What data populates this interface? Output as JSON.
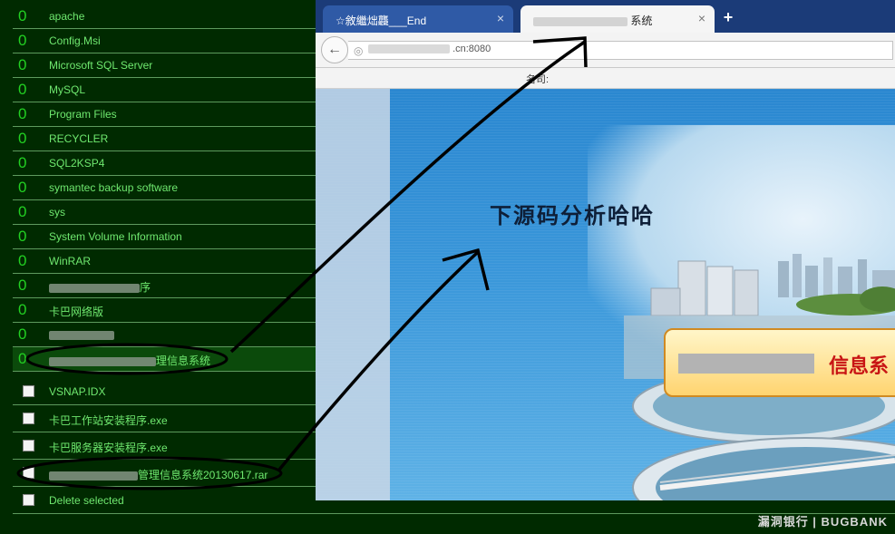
{
  "folders": [
    {
      "count": "0",
      "name": "apache"
    },
    {
      "count": "0",
      "name": "Config.Msi"
    },
    {
      "count": "0",
      "name": "Microsoft SQL Server"
    },
    {
      "count": "0",
      "name": "MySQL"
    },
    {
      "count": "0",
      "name": "Program Files"
    },
    {
      "count": "0",
      "name": "RECYCLER"
    },
    {
      "count": "0",
      "name": "SQL2KSP4"
    },
    {
      "count": "0",
      "name": "symantec backup software"
    },
    {
      "count": "0",
      "name": "sys"
    },
    {
      "count": "0",
      "name": "System Volume Information"
    },
    {
      "count": "0",
      "name": "WinRAR"
    },
    {
      "count": "0",
      "name": "序"
    },
    {
      "count": "0",
      "name": "卡巴网络版"
    },
    {
      "count": "0",
      "name": ""
    },
    {
      "count": "0",
      "name": "理信息系统"
    }
  ],
  "files": [
    {
      "name": "VSNAP.IDX"
    },
    {
      "name": "卡巴工作站安装程序.exe"
    },
    {
      "name": "卡巴服务器安装程序.exe"
    },
    {
      "name": "管理信息系统20130617.rar"
    }
  ],
  "delete_label": "Delete selected",
  "browser": {
    "tab1_title": "☆敘繼炪龘___End",
    "tab2_title": "系统",
    "tab_close": "×",
    "new_tab": "+",
    "url_text": ".cn:8080",
    "bookmark_label": "名司:",
    "back_icon": "back-arrow-icon",
    "globe_icon": "globe-icon"
  },
  "page": {
    "slogan": "下源码分析哈哈",
    "banner_text": "信息系"
  },
  "watermark": "漏洞银行 | BUGBANK",
  "colors": {
    "pane_bg": "#002a00",
    "folder_text": "#6fe86f",
    "count_text": "#22d022",
    "banner_text": "#c81414",
    "tab_active": "#f5f5f5",
    "tab_inactive": "#2f5aa6"
  }
}
